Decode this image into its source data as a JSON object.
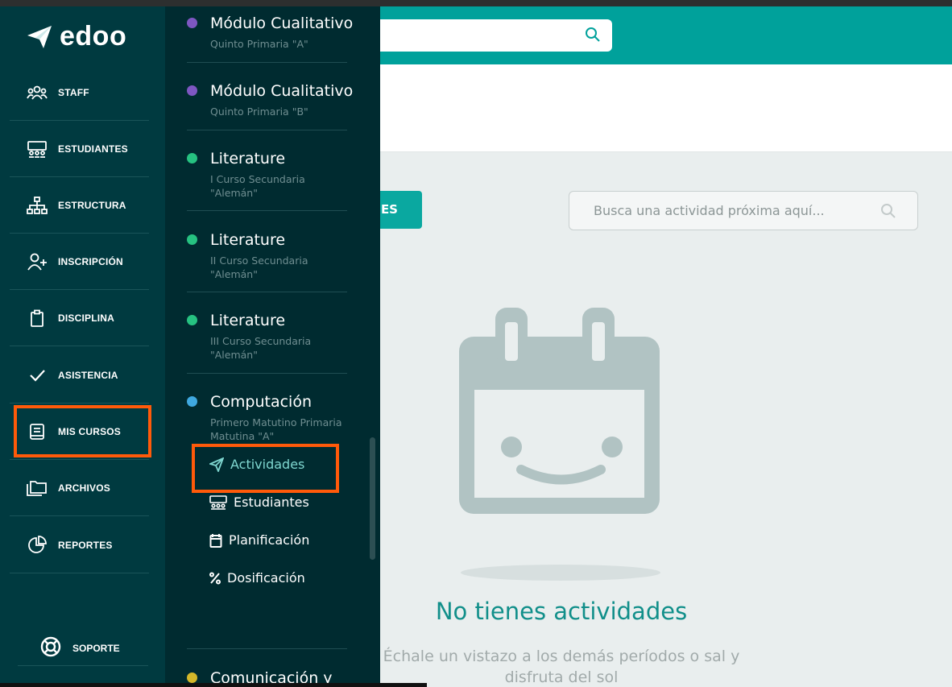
{
  "app": {
    "logo_text": "edoo"
  },
  "header": {
    "search_placeholder": ""
  },
  "nav": {
    "items": [
      {
        "key": "staff",
        "label": "STAFF",
        "icon": "users-icon"
      },
      {
        "key": "estudiantes",
        "label": "ESTUDIANTES",
        "icon": "students-icon"
      },
      {
        "key": "estructura",
        "label": "ESTRUCTURA",
        "icon": "org-chart-icon"
      },
      {
        "key": "inscripcion",
        "label": "INSCRIPCIÓN",
        "icon": "user-plus-icon"
      },
      {
        "key": "disciplina",
        "label": "DISCIPLINA",
        "icon": "clipboard-icon"
      },
      {
        "key": "asistencia",
        "label": "ASISTENCIA",
        "icon": "check-icon"
      },
      {
        "key": "mis-cursos",
        "label": "MIS CURSOS",
        "icon": "book-icon"
      },
      {
        "key": "archivos",
        "label": "ARCHIVOS",
        "icon": "folders-icon"
      },
      {
        "key": "reportes",
        "label": "REPORTES",
        "icon": "pie-chart-icon"
      }
    ],
    "support_label": "SOPORTE"
  },
  "courses": [
    {
      "name": "Módulo Cualitativo",
      "sub": "Quinto Primaria \"A\"",
      "color": "#7e57c2"
    },
    {
      "name": "Módulo Cualitativo",
      "sub": "Quinto Primaria \"B\"",
      "color": "#7e57c2"
    },
    {
      "name": "Literature",
      "sub": "I Curso Secundaria \"Alemán\"",
      "color": "#26c281"
    },
    {
      "name": "Literature",
      "sub": "II Curso Secundaria \"Alemán\"",
      "color": "#26c281"
    },
    {
      "name": "Literature",
      "sub": "III Curso Secundaria \"Alemán\"",
      "color": "#26c281"
    },
    {
      "name": "Computación",
      "sub": "Primero Matutino Primaria Matutina \"A\"",
      "color": "#3fa9e0"
    },
    {
      "name": "Comunicación y",
      "sub": "",
      "color": "#d4b82a"
    }
  ],
  "course_menu": [
    {
      "label": "Actividades",
      "icon": "send-icon",
      "active": true
    },
    {
      "label": "Estudiantes",
      "icon": "students-icon",
      "active": false
    },
    {
      "label": "Planificación",
      "icon": "calendar-icon",
      "active": false
    },
    {
      "label": "Dosificación",
      "icon": "percent-icon",
      "active": false
    }
  ],
  "main": {
    "tab_button_label": "ES",
    "search_placeholder": "Busca una actividad próxima aquí...",
    "empty_title": "No tienes actividades",
    "empty_subtitle": "Échale un vistazo a los demás períodos o sal y disfruta del sol"
  },
  "colors": {
    "teal": "#00a19b",
    "nav_bg": "#003a40",
    "highlight": "#ff5a0a"
  }
}
